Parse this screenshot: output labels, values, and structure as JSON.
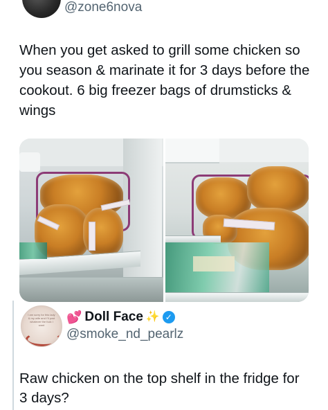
{
  "tweet": {
    "handle": "@zone6nova",
    "text": "When you get asked to grill some chicken so you season & marinate it for 3 days before the cookout. 6 big freezer bags of drumsticks & wings"
  },
  "media": {
    "photos": [
      {
        "description_icon": "photo-left"
      },
      {
        "description_icon": "photo-right"
      }
    ]
  },
  "reply": {
    "display_name": "Doll Face",
    "name_emoji_left": "💕",
    "name_emoji_right": "✨",
    "verified_mark": "✓",
    "handle": "@smoke_nd_pearlz",
    "avatar_text": "I am sorry for this lady & my wife and I'll post whatever the fuck I want",
    "text": "Raw chicken on the top shelf in the fridge for 3 days?"
  },
  "colors": {
    "verified": "#1d9bf0",
    "secondary_text": "#536471",
    "primary_text": "#0f1419"
  }
}
